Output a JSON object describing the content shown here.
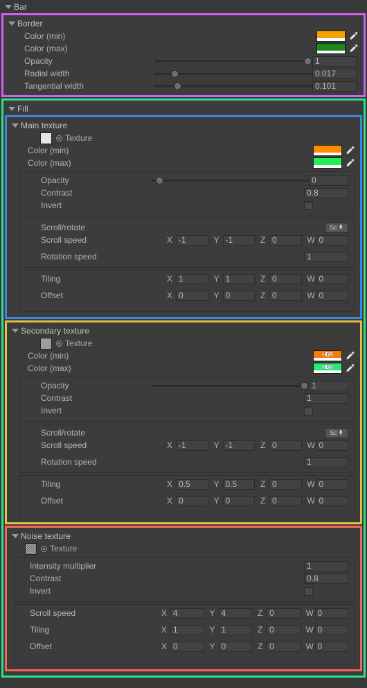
{
  "root": {
    "title": "Bar"
  },
  "common": {
    "texture_label": "Texture",
    "color_min": "Color (min)",
    "color_max": "Color (max)",
    "opacity": "Opacity",
    "contrast": "Contrast",
    "invert": "Invert",
    "scroll_rotate": "Scroll/rotate",
    "scroll_speed": "Scroll speed",
    "rotation_speed": "Rotation speed",
    "tiling": "Tiling",
    "offset": "Offset",
    "intensity_multiplier": "Intensity multiplier",
    "axis_x": "X",
    "axis_y": "Y",
    "axis_z": "Z",
    "axis_w": "W",
    "hdr_badge": "HDR",
    "popup_label": "Sc"
  },
  "border": {
    "title": "Border",
    "accent": "#d45ef0",
    "color_min": {
      "hex": "#f5a300",
      "hdr": false
    },
    "color_max": {
      "hex": "#1b8a1b",
      "hdr": false
    },
    "opacity": {
      "value": "1",
      "fill": 100
    },
    "radial_width": {
      "label": "Radial width",
      "value": "0.017",
      "fill": 11
    },
    "tangential_width": {
      "label": "Tangential width",
      "value": "0.101",
      "fill": 13
    }
  },
  "fill": {
    "title": "Fill",
    "accent": "#2ae08e"
  },
  "main_texture": {
    "title": "Main texture",
    "accent": "#3f86e0",
    "texture_thumb": "checker-light",
    "color_min": {
      "hex": "#ff8c00",
      "hdr": false
    },
    "color_max": {
      "hex": "#22ee55",
      "hdr": false
    },
    "opacity": {
      "value": "0",
      "fill": 3
    },
    "contrast": "0.8",
    "invert": false,
    "scroll_speed": {
      "x": "-1",
      "y": "-1",
      "z": "0",
      "w": "0"
    },
    "rotation_speed": "1",
    "tiling": {
      "x": "1",
      "y": "1",
      "z": "0",
      "w": "0"
    },
    "offset": {
      "x": "0",
      "y": "0",
      "z": "0",
      "w": "0"
    }
  },
  "secondary_texture": {
    "title": "Secondary texture",
    "accent": "#e0c040",
    "texture_thumb": "checker-grey",
    "color_min": {
      "hex": "#f97a0a",
      "hdr": true
    },
    "color_max": {
      "hex": "#2bea7a",
      "hdr": true
    },
    "opacity": {
      "value": "1",
      "fill": 100
    },
    "contrast": "1",
    "invert": false,
    "scroll_speed": {
      "x": "-1",
      "y": "-1",
      "z": "0",
      "w": "0"
    },
    "rotation_speed": "1",
    "tiling": {
      "x": "0.5",
      "y": "0.5",
      "z": "0",
      "w": "0"
    },
    "offset": {
      "x": "0",
      "y": "0",
      "z": "0",
      "w": "0"
    }
  },
  "noise_texture": {
    "title": "Noise texture",
    "accent": "#f4645f",
    "texture_thumb": "noise",
    "intensity_multiplier": "1",
    "contrast": "0.8",
    "invert": false,
    "scroll_speed": {
      "x": "4",
      "y": "4",
      "z": "0",
      "w": "0"
    },
    "tiling": {
      "x": "1",
      "y": "1",
      "z": "0",
      "w": "0"
    },
    "offset": {
      "x": "0",
      "y": "0",
      "z": "0",
      "w": "0"
    }
  }
}
